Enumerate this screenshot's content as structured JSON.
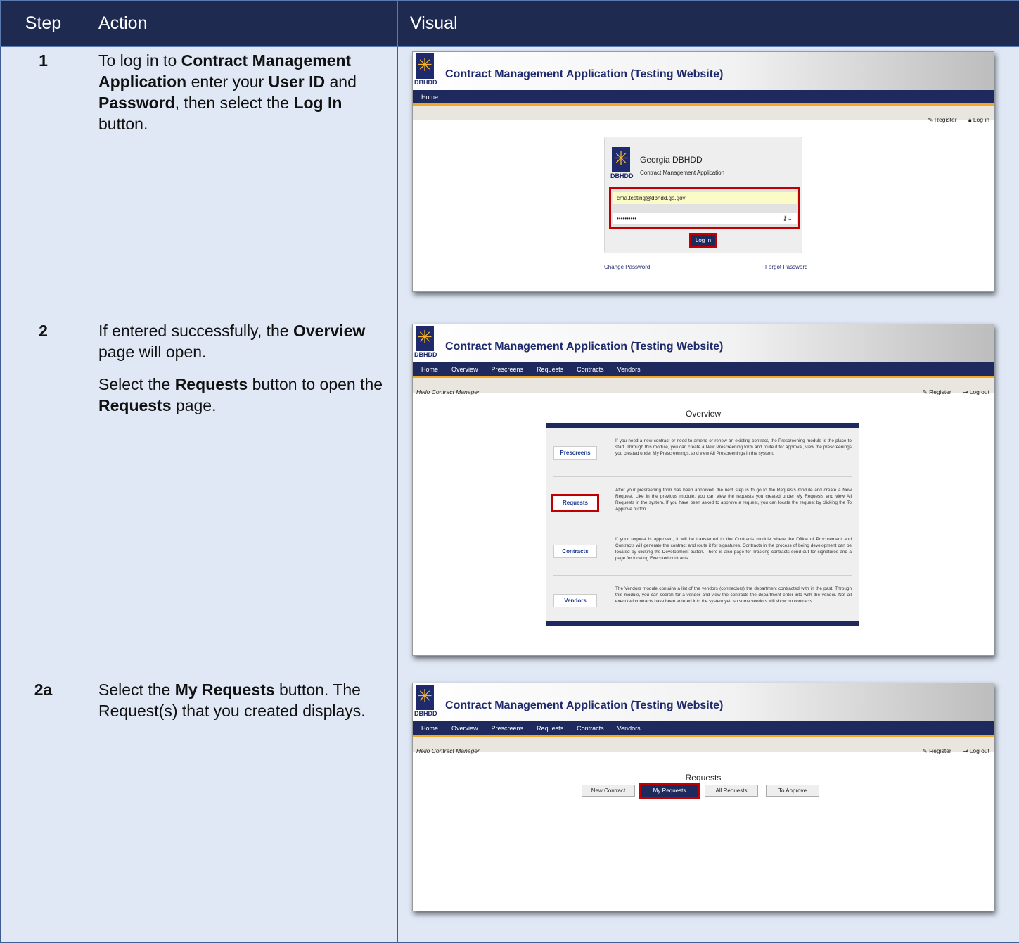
{
  "header": {
    "step": "Step",
    "action": "Action",
    "visual": "Visual"
  },
  "app": {
    "logo_text": "DBHDD",
    "title": "Contract Management Application (Testing Website)",
    "register": "Register",
    "login": "Log in",
    "logout": "Log out",
    "hello": "Hello Contract Manager",
    "nav_home_only": [
      "Home"
    ],
    "nav_full": [
      "Home",
      "Overview",
      "Prescreens",
      "Requests",
      "Contracts",
      "Vendors"
    ]
  },
  "rows": [
    {
      "step": "1",
      "action_parts": [
        {
          "t": "To log in to ",
          "b": false
        },
        {
          "t": "Contract Management Application",
          "b": true
        },
        {
          "t": " enter your ",
          "b": false
        },
        {
          "t": "User ID",
          "b": true
        },
        {
          "t": " and ",
          "b": false
        },
        {
          "t": "Password",
          "b": true
        },
        {
          "t": ", then select the ",
          "b": false
        },
        {
          "t": "Log In",
          "b": true
        },
        {
          "t": " button.",
          "b": false
        }
      ],
      "login": {
        "heading": "Georgia DBHDD",
        "subheading": "Contract Management Application",
        "user_value": "cma.testing@dbhdd.ga.gov",
        "password_value": "••••••••••",
        "button": "Log In",
        "change_password": "Change Password",
        "forgot_password": "Forgot Password"
      }
    },
    {
      "step": "2",
      "action_p1": [
        {
          "t": "If entered successfully, the ",
          "b": false
        },
        {
          "t": "Overview",
          "b": true
        },
        {
          "t": " page will open.",
          "b": false
        }
      ],
      "action_p2": [
        {
          "t": "Select the ",
          "b": false
        },
        {
          "t": "Requests",
          "b": true
        },
        {
          "t": " button to open the ",
          "b": false
        },
        {
          "t": "Requests",
          "b": true
        },
        {
          "t": " page.",
          "b": false
        }
      ],
      "overview": {
        "title": "Overview",
        "items": [
          {
            "button": "Prescreens",
            "text": "If you need a new contract or need to amend or renew an existing contract, the Prescreening module is the place to start. Through this module, you can create a New Prescreening form and route it for approval, view the prescreenings you created under My Prescreenings, and view All Prescreenings in the system."
          },
          {
            "button": "Requests",
            "text": "After your presreening form has been approved, the next step is to go to the Requests module and create a New Request. Like in the previous module, you can view the requests you created under My Requests and view All Requests in the system. If you have been asked to approve a request, you can locate the request by clicking the To Approve button."
          },
          {
            "button": "Contracts",
            "text": "If your request is approved, it will be transferred to the Contracts module where the Office of Procurement and Contracts will generate the contract and route it for signatures. Contracts in the process of being development can be located by clicking the Development button. There is also page for Tracking contracts send out for signatures and a page for locating Executed contracts."
          },
          {
            "button": "Vendors",
            "text": "The Vendors module contains a list of the vendors (contractors) the department contracted with in the past. Through this module, you can search for a vendor and view the contracts the department enter into with the vendor. Not all executed contracts have been entered into the system yet, so some vendors will show no contracts."
          }
        ]
      }
    },
    {
      "step": "2a",
      "action_parts": [
        {
          "t": "Select the ",
          "b": false
        },
        {
          "t": "My Requests",
          "b": true
        },
        {
          "t": " button. The Request(s) that you created displays.",
          "b": false
        }
      ],
      "requests": {
        "title": "Requests",
        "buttons": [
          "New Contract",
          "My Requests",
          "All Requests",
          "To Approve"
        ]
      }
    }
  ]
}
